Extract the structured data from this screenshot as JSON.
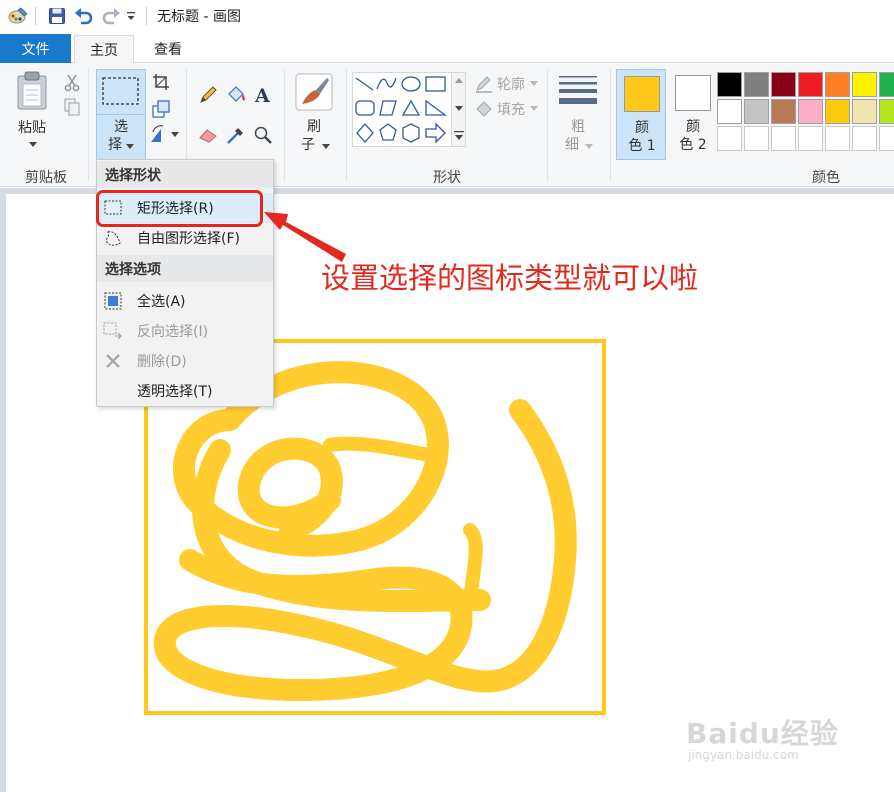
{
  "window": {
    "title": "无标题 - 画图"
  },
  "tabs": [
    {
      "label": "文件"
    },
    {
      "label": "主页"
    },
    {
      "label": "查看"
    }
  ],
  "ribbon": {
    "clipboard": {
      "paste_label": "粘贴",
      "group_label": "剪贴板"
    },
    "image": {
      "select_label_1": "选",
      "select_label_2": "择"
    },
    "brushes": {
      "label_1": "刷",
      "label_2": "子"
    },
    "shapes": {
      "outline_label": "轮廓",
      "fill_label": "填充",
      "group_label": "形状"
    },
    "size": {
      "label_1": "粗",
      "label_2": "细"
    },
    "colors": {
      "color1_label_1": "颜",
      "color1_label_2": "色 1",
      "color2_label_1": "颜",
      "color2_label_2": "色 2",
      "group_label": "颜色",
      "color1_value": "#ffc81a",
      "color2_value": "#ffffff",
      "palette_row1": [
        "#000000",
        "#7f7f7f",
        "#880015",
        "#ed1c24",
        "#ff7f27",
        "#fff200",
        "#22b14c"
      ],
      "palette_row2": [
        "#ffffff",
        "#c3c3c3",
        "#b97a57",
        "#ffaec9",
        "#ffc90e",
        "#efe4b0",
        "#b5e61d"
      ],
      "palette_row3": [
        "#ffffff",
        "#ffffff",
        "#ffffff",
        "#ffffff",
        "#ffffff",
        "#ffffff",
        "#ffffff"
      ]
    }
  },
  "select_menu": {
    "header_shapes": "选择形状",
    "rect_select": "矩形选择(R)",
    "free_select": "自由图形选择(F)",
    "header_options": "选择选项",
    "select_all": "全选(A)",
    "invert_select": "反向选择(I)",
    "delete": "删除(D)",
    "transparent_select": "透明选择(T)"
  },
  "annotation": {
    "text": "设置选择的图标类型就可以啦",
    "color": "#e5281d"
  },
  "watermark": {
    "main": "Baidu经验",
    "sub": "jingyan.baidu.com"
  },
  "drawing": {
    "stroke_color": "#ffc81a"
  }
}
